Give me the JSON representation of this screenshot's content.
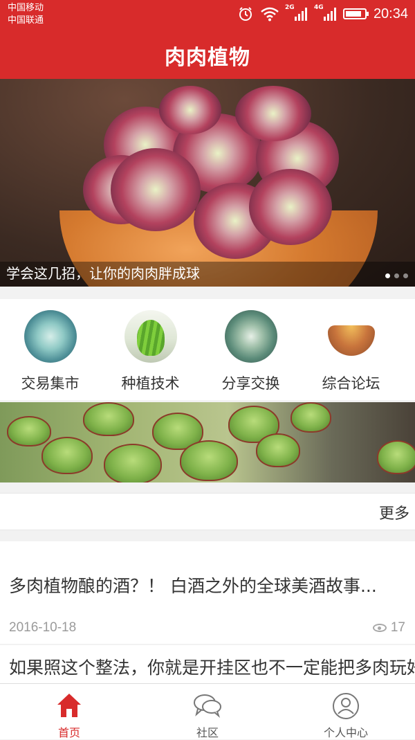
{
  "status_bar": {
    "carrier_1": "中国移动",
    "carrier_2": "中国联通",
    "network_1": "2G",
    "network_2": "4G",
    "time": "20:34",
    "battery_level": 0.85
  },
  "app_bar": {
    "title": "肉肉植物"
  },
  "banner": {
    "caption": "学会这几招，让你的肉肉胖成球",
    "page_count": 3,
    "active_page": 1
  },
  "categories": [
    {
      "label": "交易集市",
      "icon": "echeveria-blue-thumb"
    },
    {
      "label": "种植技术",
      "icon": "haworthia-green-thumb"
    },
    {
      "label": "分享交换",
      "icon": "succulent-rosette-thumb"
    },
    {
      "label": "综合论坛",
      "icon": "succulent-pot-thumb"
    }
  ],
  "more_label": "更多",
  "articles": [
    {
      "title": "多肉植物酿的酒？！ 白酒之外的全球美酒故事...",
      "date": "2016-10-18",
      "views": "17"
    },
    {
      "title": "如果照这个整法，你就是开挂区也不一定能把多肉玩好"
    }
  ],
  "bottom_nav": [
    {
      "label": "首页",
      "icon": "home-icon",
      "active": true
    },
    {
      "label": "社区",
      "icon": "chat-bubbles-icon",
      "active": false
    },
    {
      "label": "个人中心",
      "icon": "user-circle-icon",
      "active": false
    }
  ],
  "colors": {
    "primary": "#d82b2b",
    "text": "#333333",
    "muted": "#9a9a9a",
    "background": "#f2f2f2"
  }
}
